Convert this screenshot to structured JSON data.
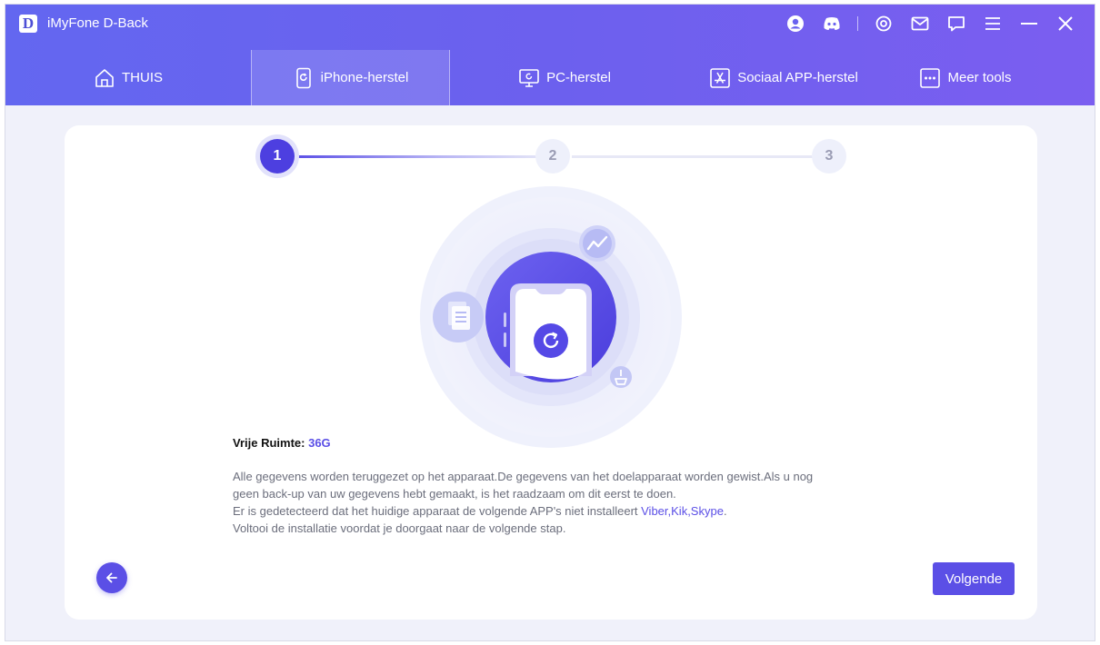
{
  "app": {
    "logo": "D",
    "title": "iMyFone D-Back"
  },
  "titlebar_icons": [
    "account-icon",
    "discord-icon",
    "settings-icon",
    "mail-icon",
    "feedback-icon",
    "menu-icon",
    "minimize-icon",
    "close-icon"
  ],
  "tabs": [
    {
      "label": "THUIS",
      "icon": "home-icon",
      "active": false
    },
    {
      "label": "iPhone-herstel",
      "icon": "iphone-restore-icon",
      "active": true
    },
    {
      "label": "PC-herstel",
      "icon": "pc-restore-icon",
      "active": false
    },
    {
      "label": "Sociaal APP-herstel",
      "icon": "app-store-icon",
      "active": false
    },
    {
      "label": "Meer tools",
      "icon": "more-tools-icon",
      "active": false
    }
  ],
  "stepper": {
    "steps": [
      "1",
      "2",
      "3"
    ],
    "current": 1
  },
  "info": {
    "free_label": "Vrije Ruimte:",
    "free_value": "36G",
    "line1": "Alle gegevens worden teruggezet op het apparaat.De gegevens van het doelapparaat worden gewist.Als u nog",
    "line2": "geen back-up van uw gegevens hebt gemaakt, is het raadzaam om dit eerst te doen.",
    "line3_prefix": "Er is gedetecteerd dat het huidige apparaat de volgende APP's niet installeert ",
    "line3_apps": "Viber,Kik,Skype",
    "line3_suffix": ".",
    "line4": "Voltooi de installatie voordat je doorgaat naar de volgende stap."
  },
  "buttons": {
    "next": "Volgende"
  },
  "colors": {
    "header_start": "#6367f0",
    "header_end": "#7b5ef0",
    "accent": "#5b4fe6",
    "background": "#f0f1fa"
  }
}
